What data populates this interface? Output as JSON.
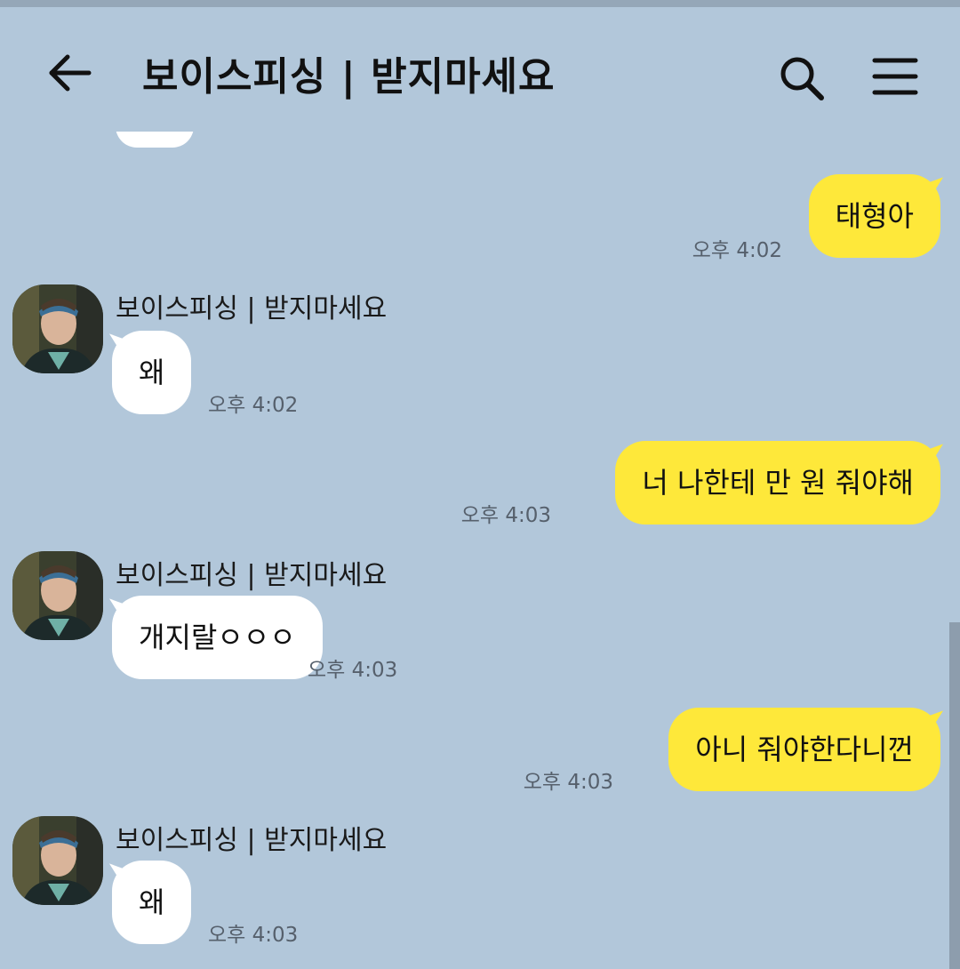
{
  "header": {
    "title": "보이스피싱 | 받지마세요",
    "back_icon": "arrow-left-icon",
    "search_icon": "search-icon",
    "menu_icon": "menu-icon"
  },
  "colors": {
    "background": "#b2c7da",
    "my_bubble": "#fee83a",
    "their_bubble": "#ffffff"
  },
  "messages": [
    {
      "from": "me",
      "text": "태형아",
      "time": "오후 4:02"
    },
    {
      "from": "them",
      "sender": "보이스피싱 | 받지마세요",
      "text": "왜",
      "time": "오후 4:02"
    },
    {
      "from": "me",
      "text": "너 나한테 만 원 줘야해",
      "time": "오후 4:03"
    },
    {
      "from": "them",
      "sender": "보이스피싱 | 받지마세요",
      "text": "개지랄ㅇㅇㅇ",
      "time": "오후 4:03"
    },
    {
      "from": "me",
      "text": "아니 줘야한다니껀",
      "time": "오후 4:03"
    },
    {
      "from": "them",
      "sender": "보이스피싱 | 받지마세요",
      "text": "왜",
      "time": "오후 4:03"
    }
  ]
}
